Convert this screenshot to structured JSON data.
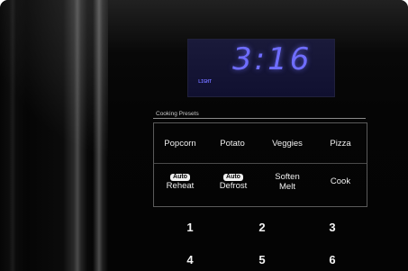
{
  "display": {
    "time": "3:16",
    "indicator": "LIGHT",
    "text_color": "#6f6dff"
  },
  "presets": {
    "label": "Cooking Presets",
    "row1": [
      "Popcorn",
      "Potato",
      "Veggies",
      "Pizza"
    ],
    "auto_badge": "Auto",
    "reheat": "Reheat",
    "defrost": "Defrost",
    "soften": "Soften",
    "melt": "Melt",
    "cook": "Cook"
  },
  "keypad": [
    "1",
    "2",
    "3",
    "4",
    "5",
    "6"
  ]
}
